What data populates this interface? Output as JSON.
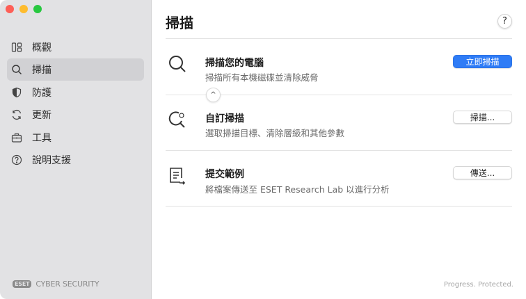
{
  "sidebar": {
    "items": [
      {
        "label": "概觀",
        "icon": "dashboard-icon"
      },
      {
        "label": "掃描",
        "icon": "search-icon",
        "selected": true
      },
      {
        "label": "防護",
        "icon": "shield-icon"
      },
      {
        "label": "更新",
        "icon": "refresh-icon"
      },
      {
        "label": "工具",
        "icon": "briefcase-icon"
      },
      {
        "label": "說明支援",
        "icon": "help-icon"
      }
    ],
    "brand_logo": "eset",
    "brand_text": "CYBER SECURITY"
  },
  "main": {
    "title": "掃描",
    "help": "?",
    "rows": [
      {
        "title": "掃描您的電腦",
        "subtitle": "掃描所有本機磁碟並清除威脅",
        "button": "立即掃描"
      },
      {
        "title": "自訂掃描",
        "subtitle": "選取掃描目標、清除層級和其他參數",
        "button": "掃描..."
      },
      {
        "title": "提交範例",
        "subtitle": "將檔案傳送至 ESET Research Lab 以進行分析",
        "button": "傳送..."
      }
    ],
    "collapse": "^",
    "footer": "Progress. Protected."
  },
  "colors": {
    "accent": "#2f7cf6",
    "sidebar": "#e2e2e4"
  }
}
